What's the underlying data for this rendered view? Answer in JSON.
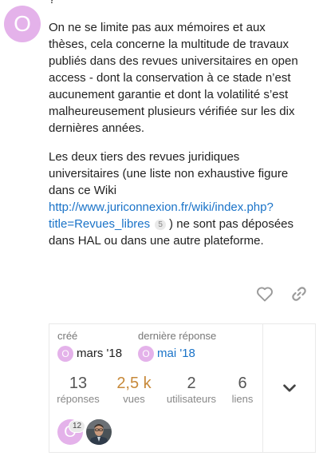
{
  "post": {
    "author_initial": "O",
    "top_fragment": "?",
    "paragraph1": "On ne se limite pas aux mémoires et aux thèses, cela concerne la multitude de travaux publiés dans des revues universitaires en open access - dont la conservation à ce stade n’est aucunement garantie et dont la volatilité s’est malheureusement plusieurs vérifiée sur les dix dernières années.",
    "paragraph2_before": "Les deux tiers des revues juridiques universitaires (une liste non exhaustive figure dans ce Wiki ",
    "link_text": "http://www.juriconnexion.fr/wiki/index.php?title=Revues_libres",
    "link_clicks": "5",
    "paragraph2_after": " ) ne sont pas déposées dans HAL ou dans une autre plateforme.",
    "actions": {
      "like_icon": "heart-outline-icon",
      "share_icon": "link-icon"
    }
  },
  "topic_map": {
    "created_label": "créé",
    "created_initial": "O",
    "created_date": "mars '18",
    "last_reply_label": "dernière réponse",
    "last_reply_initial": "O",
    "last_reply_date": "mai '18",
    "stats": [
      {
        "value": "13",
        "caption": "réponses"
      },
      {
        "value": "2,5 k",
        "caption": "vues"
      },
      {
        "value": "2",
        "caption": "utilisateurs"
      },
      {
        "value": "6",
        "caption": "liens"
      }
    ],
    "participants": {
      "first_initial": "O",
      "first_post_count": "12"
    },
    "expand_icon": "chevron-down-icon"
  },
  "colors": {
    "avatar": "#e4b2ea",
    "link": "#1a73c8",
    "views_highlight": "#c7893a"
  }
}
